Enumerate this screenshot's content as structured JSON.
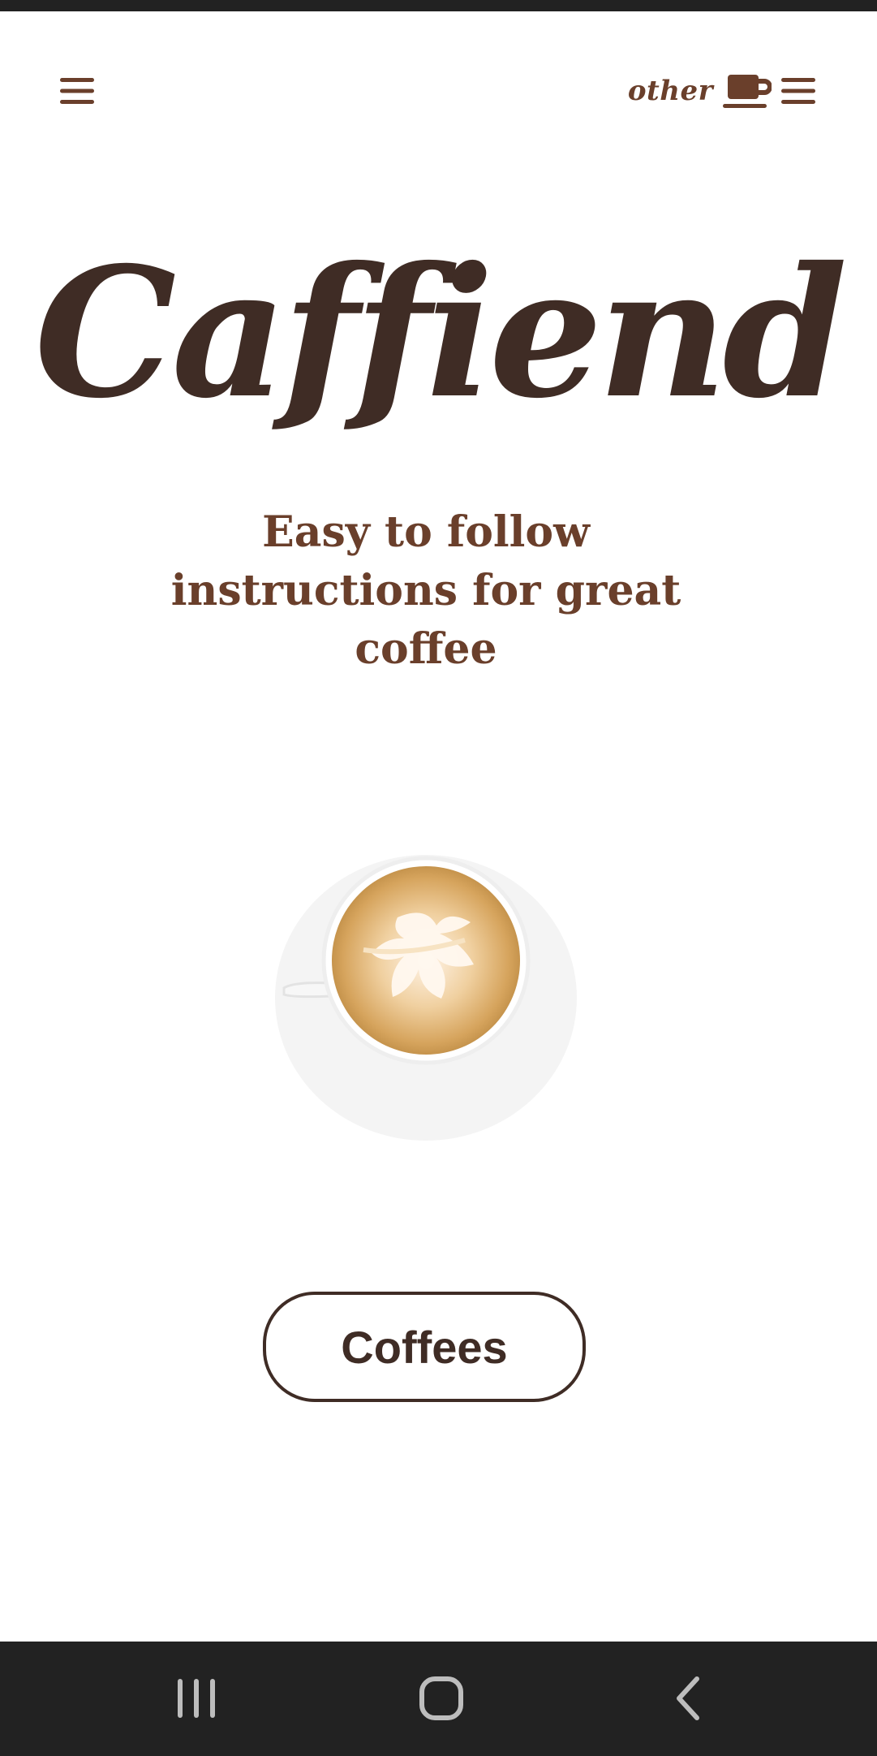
{
  "app": {
    "title": "Caffiend",
    "subtitle": "Easy to follow instructions for great coffee"
  },
  "header": {
    "left_icon": "hamburger-menu-icon",
    "right_label": "other",
    "right_cup_icon": "coffee-cup-icon",
    "right_menu_icon": "hamburger-menu-icon"
  },
  "main": {
    "image": "latte-cup-image",
    "button_label": "Coffees"
  },
  "system_nav": {
    "recent_icon": "recent-apps-icon",
    "home_icon": "home-icon",
    "back_icon": "back-icon"
  },
  "colors": {
    "primary_text": "#3f2c25",
    "accent": "#6a3f2b",
    "nav_bg": "#222222",
    "background": "#ffffff"
  }
}
